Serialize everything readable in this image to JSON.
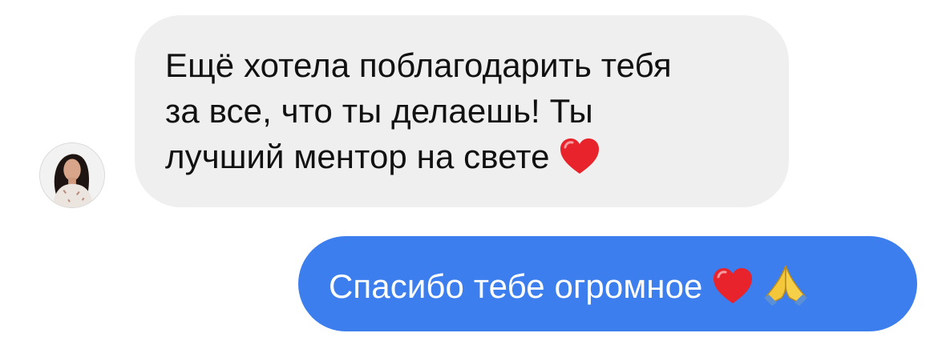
{
  "conversation": {
    "incoming": {
      "lines": [
        "Ещё хотела поблагодарить тебя",
        "за все, что ты делаешь! Ты",
        "лучший ментор на свете"
      ],
      "emoji": "heart-icon",
      "bubble_color": "#efefef"
    },
    "outgoing": {
      "text": "Спасибо тебе огромное",
      "emojis": [
        "heart-icon",
        "folded-hands-icon"
      ],
      "bubble_color": "#3c7eee"
    }
  }
}
